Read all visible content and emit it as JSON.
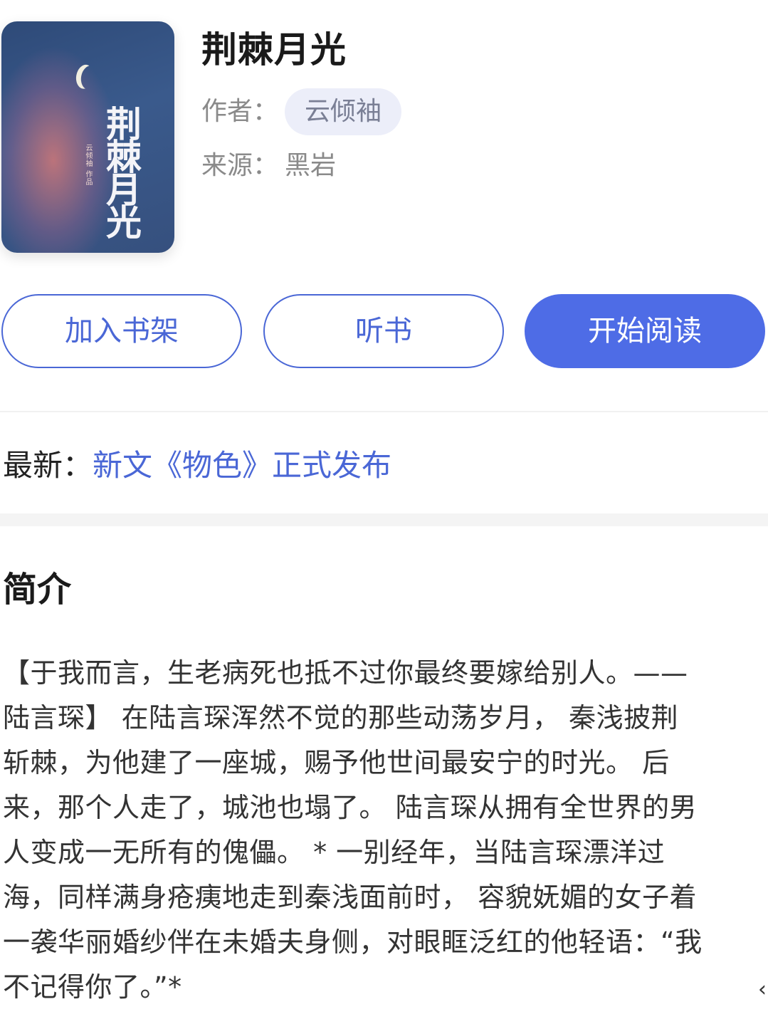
{
  "book": {
    "title": "荆棘月光",
    "cover_title": "荆棘月光",
    "cover_subtitle": "云倾袖 作品",
    "author_label": "作者：",
    "author": "云倾袖",
    "source_label": "来源：",
    "source": "黑岩"
  },
  "actions": {
    "add_shelf": "加入书架",
    "listen": "听书",
    "start_reading": "开始阅读"
  },
  "latest": {
    "label": "最新：",
    "text": "新文《物色》正式发布"
  },
  "intro": {
    "heading": "简介",
    "lines": [
      "【于我而言，生老病死也抵不过你最终要嫁给别人。——",
      "陆言琛】 在陆言琛浑然不觉的那些动荡岁月， 秦浅披荆",
      "斩棘，为他建了一座城，赐予他世间最安宁的时光。 后",
      "来，那个人走了，城池也塌了。 陆言琛从拥有全世界的男",
      "人变成一无所有的傀儡。 * 一别经年，当陆言琛漂洋过",
      "海，同样满身疮痍地走到秦浅面前时， 容貌妩媚的女子着",
      "一袭华丽婚纱伴在未婚夫身侧，对眼眶泛红的他轻语：“我",
      "不记得你了。”*"
    ]
  },
  "colors": {
    "accent": "#4e6ce6",
    "chip_bg": "#eceef9",
    "muted_text": "#8a8a8a"
  }
}
